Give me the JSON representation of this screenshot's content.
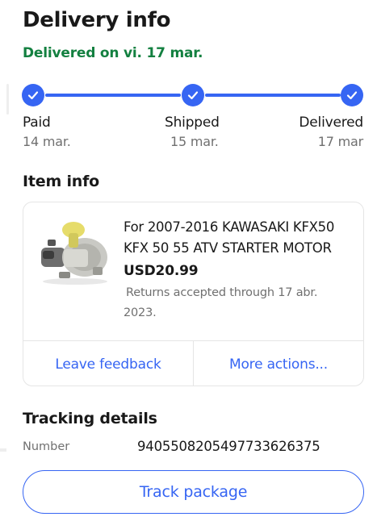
{
  "header": {
    "title": "Delivery info",
    "delivered_on": "Delivered on vi. 17 mar."
  },
  "tracker": {
    "accent_color": "#3665f3",
    "steps": [
      {
        "label": "Paid",
        "date": "14 mar.",
        "icon": "check-icon",
        "complete": true
      },
      {
        "label": "Shipped",
        "date": "15 mar.",
        "icon": "check-icon",
        "complete": true
      },
      {
        "label": "Delivered",
        "date": "17 mar",
        "icon": "check-icon",
        "complete": true
      }
    ]
  },
  "item_info": {
    "section_title": "Item info",
    "title": "For 2007-2016 KAWASAKI KFX50 KFX 50 55 ATV STARTER MOTOR",
    "price": "USD20.99",
    "returns": "Returns accepted through 17 abr. 2023.",
    "image": "starter-motor-photo",
    "actions": {
      "feedback": "Leave feedback",
      "more": "More actions..."
    }
  },
  "tracking": {
    "section_title": "Tracking details",
    "number_label": "Number",
    "number_value": "9405508205497733626375",
    "track_button": "Track package"
  },
  "colors": {
    "success_green": "#138040",
    "link_blue": "#3665f3",
    "text_primary": "#191919",
    "text_secondary": "#707070"
  }
}
